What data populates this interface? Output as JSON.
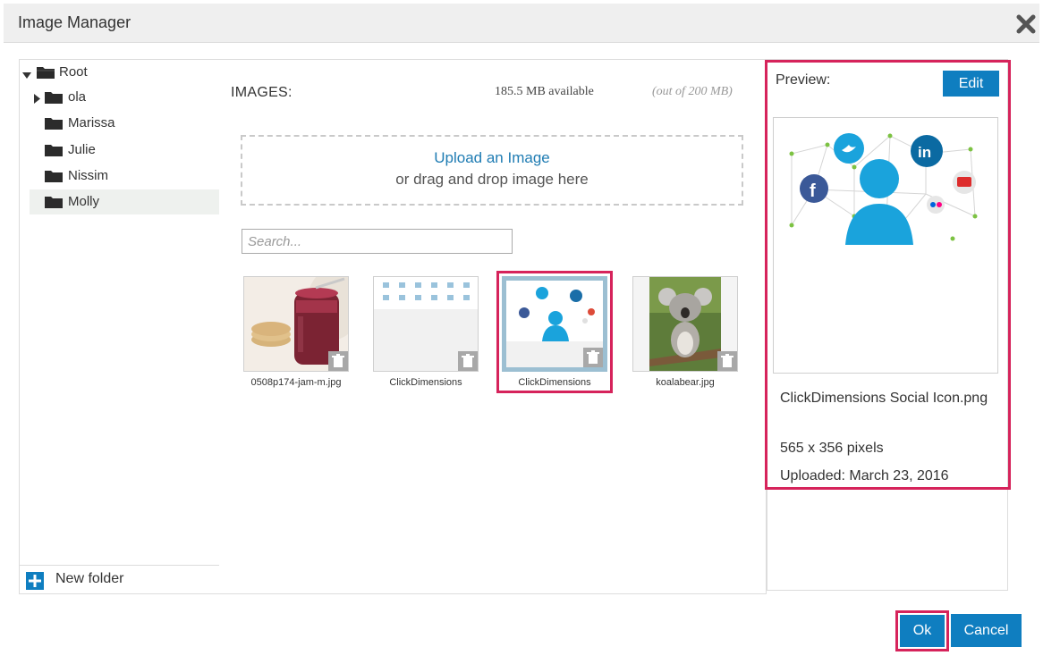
{
  "window": {
    "title": "Image Manager",
    "close_icon": "close-icon"
  },
  "folders": {
    "items": [
      {
        "label": "Root",
        "expanded": true
      },
      {
        "label": "ola",
        "collapsed": true
      },
      {
        "label": "Marissa"
      },
      {
        "label": "Julie"
      },
      {
        "label": "Nissim"
      },
      {
        "label": "Molly",
        "selected": true
      }
    ],
    "new_folder_label": "New folder"
  },
  "images": {
    "heading": "IMAGES:",
    "available": "185.5 MB available",
    "quota": "(out of 200 MB)",
    "upload_link": "Upload an Image",
    "drag_text": "or drag and drop image here",
    "search_placeholder": "Search...",
    "thumbnails": [
      {
        "caption": "0508p174-jam-m.jpg"
      },
      {
        "caption": "ClickDimensions"
      },
      {
        "caption": "ClickDimensions",
        "selected": true
      },
      {
        "caption": "koalabear.jpg"
      }
    ]
  },
  "preview": {
    "label": "Preview:",
    "edit_label": "Edit",
    "filename": "ClickDimensions Social Icon.png",
    "dimensions": "565 x 356 pixels",
    "uploaded": "Uploaded: March 23, 2016"
  },
  "footer": {
    "ok_label": "Ok",
    "cancel_label": "Cancel"
  },
  "colors": {
    "accent": "#0f7ec0",
    "highlight": "#d6235b",
    "link": "#1f7cb3"
  }
}
